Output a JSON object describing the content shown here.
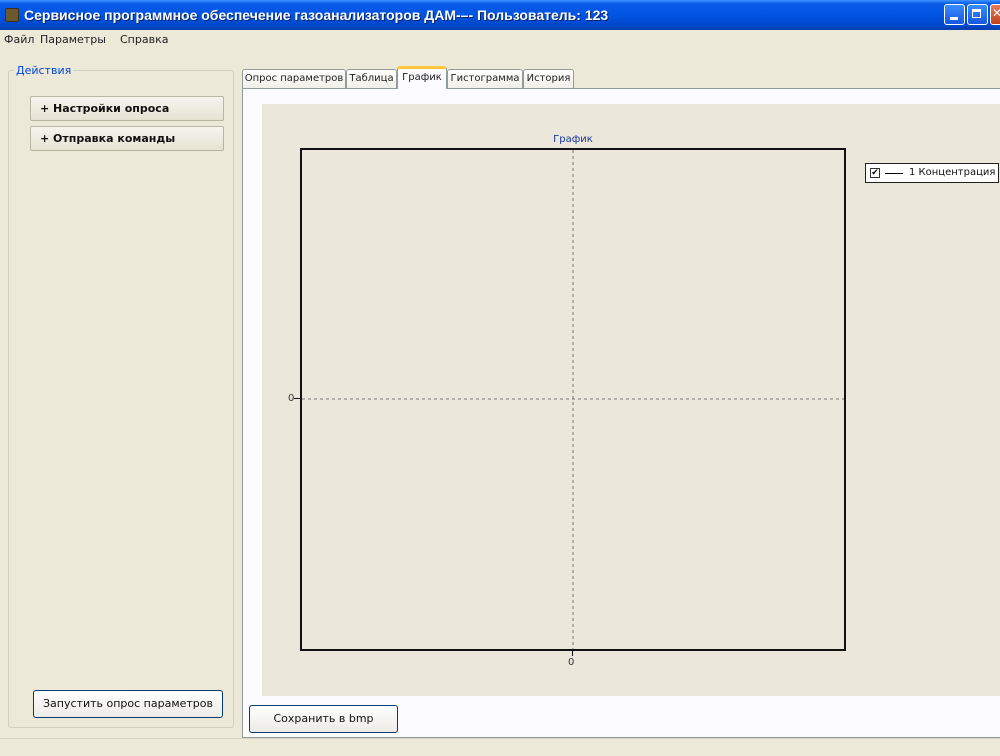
{
  "window": {
    "title": "Сервисное программное обеспечение газоанализаторов ДАМ-–- Пользователь: 123"
  },
  "menu": {
    "items": [
      "Файл",
      "Параметры",
      "Справка"
    ]
  },
  "actions": {
    "group_label": "Действия",
    "poll_settings_label": "+ Настройки опроса",
    "send_command_label": "+ Отправка команды",
    "start_poll_label": "Запустить опрос параметров"
  },
  "tabs": {
    "items": [
      "Опрос параметров",
      "Таблица",
      "График",
      "Гистограмма",
      "История"
    ],
    "active": "График"
  },
  "save_button_label": "Сохранить в bmp",
  "chart_data": {
    "type": "line",
    "title": "График",
    "series": [
      {
        "name": "1 Концентрация",
        "values": [],
        "checked": true
      }
    ],
    "x_ticks": [
      "0"
    ],
    "y_ticks": [
      "0"
    ],
    "xlabel": "",
    "ylabel": "",
    "grid": true,
    "legend_position": "right"
  }
}
